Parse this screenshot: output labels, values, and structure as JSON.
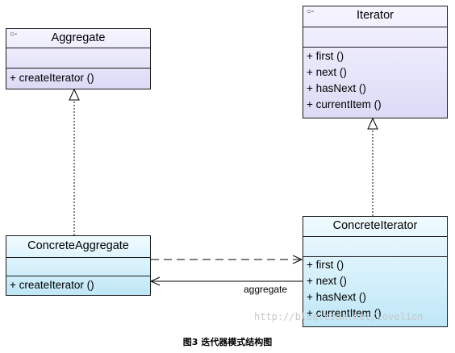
{
  "classes": {
    "aggregate": {
      "stereotype": "○-",
      "name": "Aggregate",
      "operations": [
        "+ createIterator ()"
      ]
    },
    "iterator": {
      "stereotype": "○-",
      "name": "Iterator",
      "operations": [
        "+ first ()",
        "+ next ()",
        "+ hasNext ()",
        "+ currentItem ()"
      ]
    },
    "concrete_aggregate": {
      "name": "ConcreteAggregate",
      "operations": [
        "+ createIterator ()"
      ]
    },
    "concrete_iterator": {
      "name": "ConcreteIterator",
      "operations": [
        "+ first ()",
        "+ next ()",
        "+ hasNext ()",
        "+ currentItem ()"
      ]
    }
  },
  "association": {
    "role_label": "aggregate"
  },
  "watermark": "http://blog.csdn.net/lovelion",
  "caption": "图3 迭代器模式结构图",
  "colors": {
    "interface_fill": "#dcdaf6",
    "concrete_fill": "#bfe7f7",
    "border": "#1a1a1a"
  }
}
